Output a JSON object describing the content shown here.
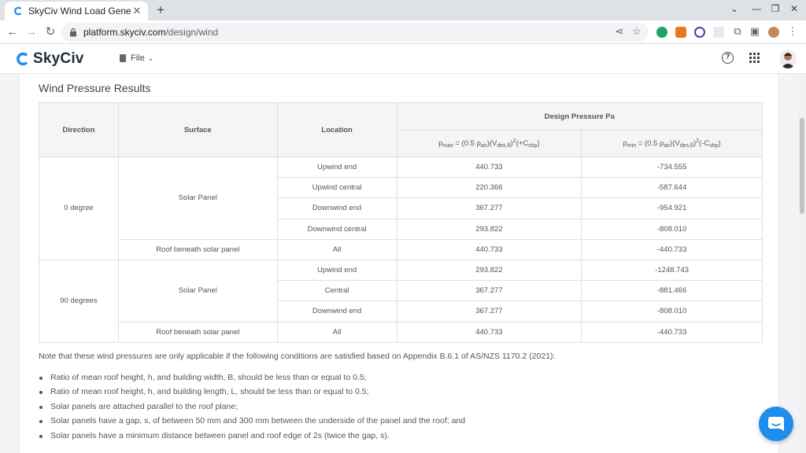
{
  "browser": {
    "tab_title": "SkyCiv Wind Load Generat",
    "url_host": "platform.skyciv.com",
    "url_path": "/design/wind",
    "colors": {
      "tabstrip": "#dee1e6",
      "ext_green": "#1fa463",
      "ext_orange": "#f0761c",
      "ext_purple": "#4b3fa8"
    },
    "icons": [
      "back-arrow-icon",
      "forward-arrow-icon",
      "reload-icon",
      "lock-icon",
      "share-icon",
      "star-icon",
      "puzzle-icon",
      "sidebar-icon",
      "kebab-menu-icon"
    ]
  },
  "app": {
    "brand": "SkyCiv",
    "file_menu": "File",
    "brand_color": "#1f8ded"
  },
  "results": {
    "title": "Wind Pressure Results",
    "headers": {
      "direction": "Direction",
      "surface": "Surface",
      "location": "Location",
      "design_pressure": "Design Pressure Pa",
      "pmax_p": "p",
      "pmax_sub": "max",
      "pmax_mid": " = (0.5 ρ",
      "pmax_air": "air",
      "pmax_v": ")(V",
      "pmax_des": "des,θ",
      "pmax_sq": "2",
      "pmax_tail": "(+C",
      "pmax_shp": "shp",
      "pmax_end": ")",
      "pmin_p": "p",
      "pmin_sub": "min",
      "pmin_mid": " = (0.5 ρ",
      "pmin_air": "air",
      "pmin_v": ")(V",
      "pmin_des": "des,θ",
      "pmin_sq": "2",
      "pmin_tail": "(-C",
      "pmin_shp": "shp",
      "pmin_end": ")"
    },
    "groups": [
      {
        "direction": "0 degree",
        "panel_surface": "Solar Panel",
        "panel_rows": [
          {
            "location": "Upwind end",
            "pmax": "440.733",
            "pmin": "-734.555"
          },
          {
            "location": "Upwind central",
            "pmax": "220.366",
            "pmin": "-587.644"
          },
          {
            "location": "Downwind end",
            "pmax": "367.277",
            "pmin": "-954.921"
          },
          {
            "location": "Downwind central",
            "pmax": "293.822",
            "pmin": "-808.010"
          }
        ],
        "roof_surface": "Roof beneath solar panel",
        "roof_row": {
          "location": "All",
          "pmax": "440.733",
          "pmin": "-440.733"
        }
      },
      {
        "direction": "90 degrees",
        "panel_surface": "Solar Panel",
        "panel_rows": [
          {
            "location": "Upwind end",
            "pmax": "293.822",
            "pmin": "-1248.743"
          },
          {
            "location": "Central",
            "pmax": "367.277",
            "pmin": "-881.466"
          },
          {
            "location": "Downwind end",
            "pmax": "367.277",
            "pmin": "-808.010"
          }
        ],
        "roof_surface": "Roof beneath solar panel",
        "roof_row": {
          "location": "All",
          "pmax": "440.733",
          "pmin": "-440.733"
        }
      }
    ]
  },
  "note": "Note that these wind pressures are only applicable if the following conditions are satisfied based on Appendix B.6.1 of AS/NZS 1170.2 (2021):",
  "conditions": [
    "Ratio of mean roof height, h, and building width, B, should be less than or equal to 0.5;",
    "Ratio of mean roof height, h, and building length, L, should be less than or equal to 0.5;",
    "Solar panels are attached parallel to the roof plane;",
    "Solar panels have a gap, s, of between 50 mm and 300 mm between the underside of the panel and the roof; and",
    "Solar panels have a minimum distance between panel and roof edge of 2s (twice the gap, s)."
  ]
}
